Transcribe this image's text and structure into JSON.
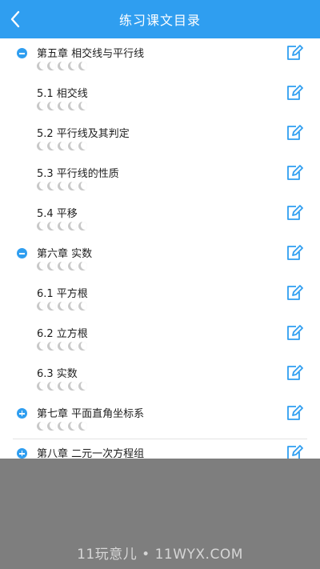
{
  "header": {
    "title": "练习课文目录",
    "back_icon": "chevron-left-icon"
  },
  "colors": {
    "accent": "#2f9ef0",
    "overlay": "#7e7e7e"
  },
  "list": {
    "items": [
      {
        "label": "第五章 相交线与平行线",
        "level": "chapter",
        "expanded": true,
        "stars_filled": 0
      },
      {
        "label": "5.1 相交线",
        "level": "section",
        "stars_filled": 0
      },
      {
        "label": "5.2 平行线及其判定",
        "level": "section",
        "stars_filled": 0
      },
      {
        "label": "5.3 平行线的性质",
        "level": "section",
        "stars_filled": 0
      },
      {
        "label": "5.4 平移",
        "level": "section",
        "stars_filled": 0
      },
      {
        "label": "第六章 实数",
        "level": "chapter",
        "expanded": true,
        "stars_filled": 0
      },
      {
        "label": "6.1 平方根",
        "level": "section",
        "stars_filled": 0
      },
      {
        "label": "6.2 立方根",
        "level": "section",
        "stars_filled": 0
      },
      {
        "label": "6.3 实数",
        "level": "section",
        "stars_filled": 0
      },
      {
        "label": "第七章 平面直角坐标系",
        "level": "chapter",
        "expanded": false,
        "stars_filled": 0
      },
      {
        "label": "第八章 二元一次方程组",
        "level": "chapter",
        "expanded": false,
        "stars_filled": 0
      }
    ]
  },
  "watermark": "11玩意儿 • 11WYX.COM"
}
